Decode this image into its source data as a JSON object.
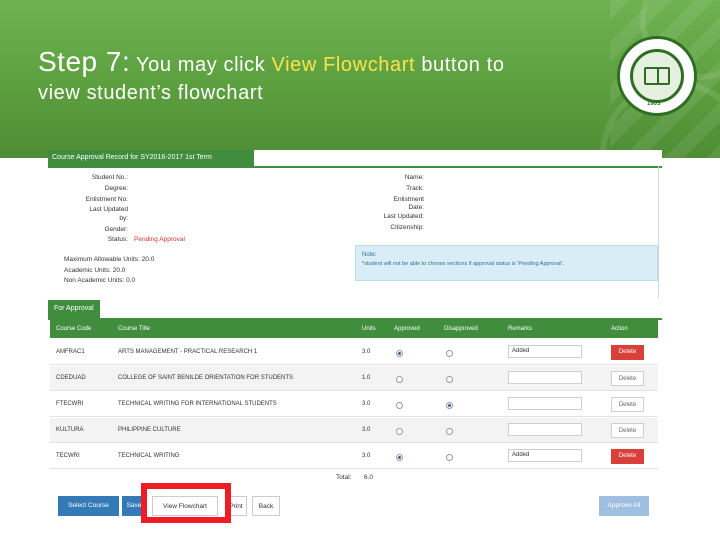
{
  "slide": {
    "step_label": "Step 7:",
    "title_part1": " You may click ",
    "title_highlight": "View Flowchart",
    "title_part2": " button to",
    "title_line2": "view student’s flowchart",
    "accent_color": "#ffe14b",
    "banner_color": "#5c9f3f",
    "logo_year": "1905"
  },
  "record": {
    "section_title": "Course Approval Record for SY2016-2017 1st Term",
    "left_labels": [
      "Student No.:",
      "Degree:",
      "Enlistment No:",
      "Last Updated",
      "by:",
      "Gender:",
      "Status:"
    ],
    "status_value": "Pending Approval",
    "right_labels": [
      "Name:",
      "Track:",
      "Enlistment",
      "Date:",
      "Last Updated:",
      "Citizenship:"
    ],
    "max_units": "Maximum Allowable Units: 20.0",
    "academic_units": "Academic Units: 20.0",
    "non_academic_units": "Non Academic Units: 0.0",
    "note_title": "Note:",
    "note_text": "*student will not be able to choose sections if approval status is 'Pending Approval'."
  },
  "approval": {
    "tab_label": "For Approval",
    "columns": [
      "Course Code",
      "Course Title",
      "Units",
      "Approved",
      "Disapproved",
      "Remarks",
      "Action"
    ],
    "rows": [
      {
        "code": "AMFRAC1",
        "title": "ARTS MANAGEMENT - PRACTICAL RESEARCH 1",
        "units": "3.0",
        "approved": "checked",
        "disapproved": "empty",
        "remark": "Added",
        "action": "Delete",
        "action_style": "red"
      },
      {
        "code": "CDEDUAD",
        "title": "COLLEGE OF SAINT BENILDE ORIENTATION FOR STUDENTS",
        "units": "1.0",
        "approved": "empty",
        "disapproved": "empty",
        "remark": "",
        "action": "Delete",
        "action_style": "grey"
      },
      {
        "code": "FTECWRI",
        "title": "TECHNICAL WRITING FOR INTERNATIONAL STUDENTS",
        "units": "3.0",
        "approved": "empty",
        "disapproved": "checked",
        "remark": "",
        "action": "Delete",
        "action_style": "grey"
      },
      {
        "code": "KULTURA",
        "title": "PHILIPPINE CULTURE",
        "units": "3.0",
        "approved": "empty",
        "disapproved": "empty",
        "remark": "",
        "action": "Delete",
        "action_style": "grey"
      },
      {
        "code": "TECWRI",
        "title": "TECHNICAL WRITING",
        "units": "3.0",
        "approved": "checked",
        "disapproved": "empty",
        "remark": "Added",
        "action": "Delete",
        "action_style": "red"
      }
    ],
    "total_label": "Total:",
    "total_value": "6.0"
  },
  "buttons": {
    "select_course": "Select Course",
    "save": "Save",
    "view_flowchart": "View Flowchart",
    "print": "Print",
    "back": "Back",
    "approve_all": "Approve All"
  }
}
